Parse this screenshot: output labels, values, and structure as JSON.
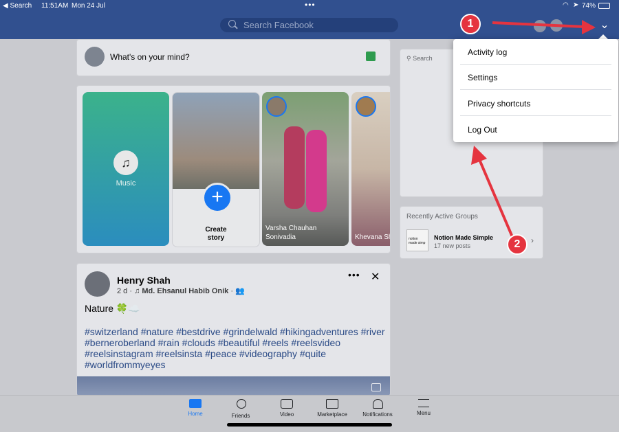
{
  "status_bar": {
    "back": "◀ Search",
    "time": "11:51AM",
    "date": "Mon 24 Jul",
    "battery": "74%"
  },
  "header": {
    "search_placeholder": "Search Facebook"
  },
  "composer": {
    "prompt": "What's on your mind?"
  },
  "stories": [
    {
      "label": "Music"
    },
    {
      "label_line1": "Create",
      "label_line2": "story"
    },
    {
      "name_line1": "Varsha Chauhan",
      "name_line2": "Sonivadia"
    },
    {
      "name_line1": "Khevana Sh"
    }
  ],
  "post": {
    "author": "Henry Shah",
    "meta_time": "2 d ·",
    "meta_audio": "Md. Ehsanul Habib Onik",
    "meta_sep": "·",
    "text": "Nature 🍀☁️",
    "hashtags": [
      "#switzerland #nature #bestdrive #grindelwald #hikingadventures #river",
      "#berneroberland #rain #clouds #beautiful #reels #reelsvideo",
      "#reelsinstagram #reelsinsta #peace #videography #quite",
      "#worldfrommyeyes"
    ]
  },
  "right_panel": {
    "search_placeholder": "Search",
    "groups_title": "Recently Active Groups",
    "group_name": "Notion Made Simple",
    "group_posts": "17 new posts"
  },
  "dropdown": {
    "items": [
      "Activity log",
      "Settings",
      "Privacy shortcuts",
      "Log Out"
    ]
  },
  "tabbar": {
    "tabs": [
      "Home",
      "Friends",
      "Video",
      "Marketplace",
      "Notifications",
      "Menu"
    ]
  },
  "annotations": {
    "badge1": "1",
    "badge2": "2"
  },
  "colors": {
    "header": "#31508f",
    "accent": "#1877f2",
    "annotation": "#e5343f"
  }
}
